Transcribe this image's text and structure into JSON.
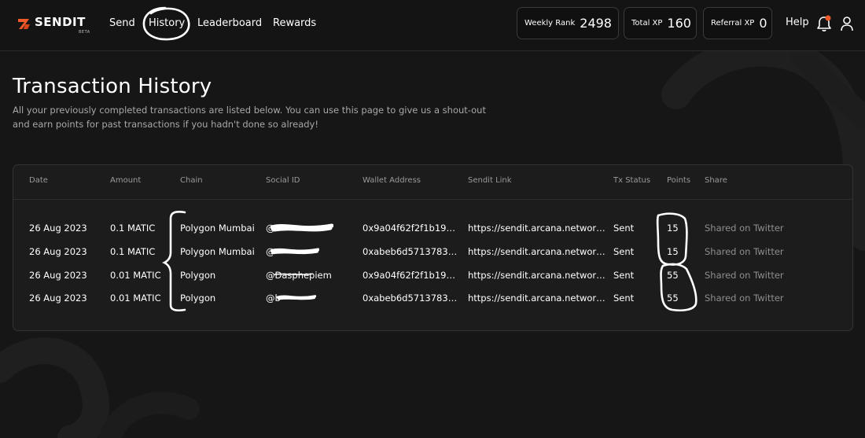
{
  "header": {
    "logo_text": "SENDIT",
    "logo_badge": "BETA",
    "nav": [
      {
        "label": "Send"
      },
      {
        "label": "History"
      },
      {
        "label": "Leaderboard"
      },
      {
        "label": "Rewards"
      }
    ],
    "stats": [
      {
        "label": "Weekly Rank",
        "value": "2498"
      },
      {
        "label": "Total XP",
        "value": "160"
      },
      {
        "label": "Referral XP",
        "value": "0"
      }
    ],
    "help_label": "Help",
    "colors": {
      "accent": "#f05a28",
      "notification_dot": "#f05a28"
    }
  },
  "page": {
    "title": "Transaction History",
    "description": "All your previously completed transactions are listed below. You can use this page to give us a shout-out and earn points for past transactions if you hadn't done so already!"
  },
  "table": {
    "columns": [
      "Date",
      "Amount",
      "Chain",
      "Social ID",
      "Wallet Address",
      "Sendit Link",
      "Tx Status",
      "Points",
      "Share"
    ],
    "rows": [
      {
        "date": "26 Aug 2023",
        "amount": "0.1 MATIC",
        "chain": "Polygon Mumbai",
        "social": "@",
        "wallet": "0x9a04f62f2f1b1989...",
        "link": "https://sendit.arcana.network/i...",
        "status": "Sent",
        "points": "15",
        "share": "Shared on Twitter"
      },
      {
        "date": "26 Aug 2023",
        "amount": "0.1 MATIC",
        "chain": "Polygon Mumbai",
        "social": "@",
        "wallet": "0xabeb6d5713783e3...",
        "link": "https://sendit.arcana.network/i...",
        "status": "Sent",
        "points": "15",
        "share": "Shared on Twitter"
      },
      {
        "date": "26 Aug 2023",
        "amount": "0.01 MATIC",
        "chain": "Polygon",
        "social": "@Dasphepiem",
        "wallet": "0x9a04f62f2f1b1989...",
        "link": "https://sendit.arcana.network/i...",
        "status": "Sent",
        "points": "55",
        "share": "Shared on Twitter"
      },
      {
        "date": "26 Aug 2023",
        "amount": "0.01 MATIC",
        "chain": "Polygon",
        "social": "@b",
        "wallet": "0xabeb6d5713783e3...",
        "link": "https://sendit.arcana.network/i...",
        "status": "Sent",
        "points": "55",
        "share": "Shared on Twitter"
      }
    ]
  }
}
